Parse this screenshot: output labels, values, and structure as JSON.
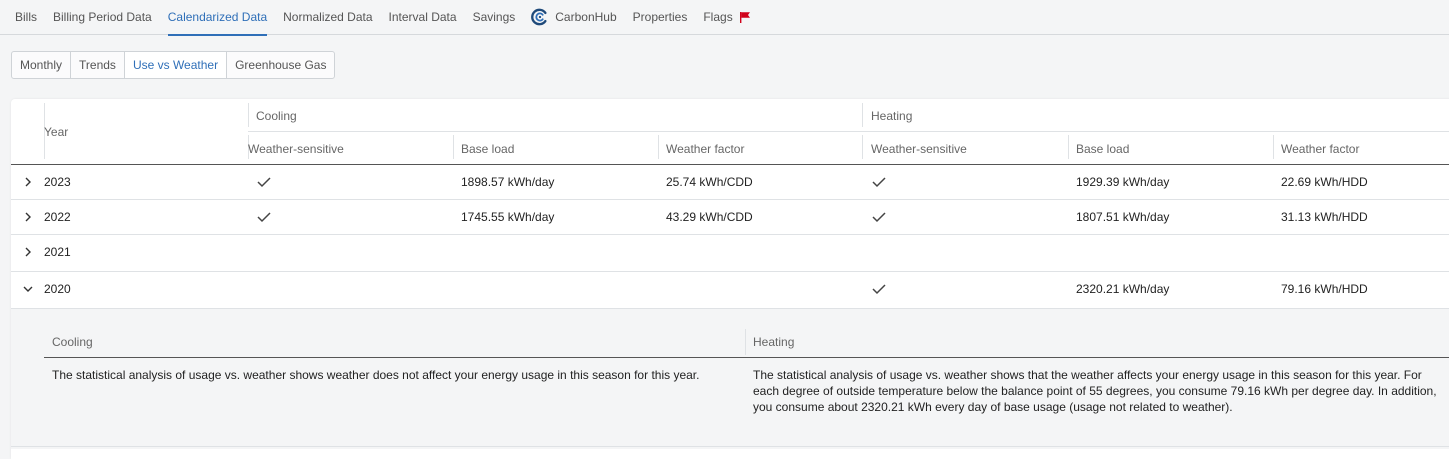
{
  "nav": {
    "tabs": [
      {
        "label": "Bills",
        "active": false
      },
      {
        "label": "Billing Period Data",
        "active": false
      },
      {
        "label": "Calendarized Data",
        "active": true
      },
      {
        "label": "Normalized Data",
        "active": false
      },
      {
        "label": "Interval Data",
        "active": false
      },
      {
        "label": "Savings",
        "active": false
      },
      {
        "label": "CarbonHub",
        "active": false,
        "icon": "carbonhub-logo-icon"
      },
      {
        "label": "Properties",
        "active": false
      },
      {
        "label": "Flags",
        "active": false,
        "icon": "flag-icon"
      }
    ]
  },
  "subtabs": [
    {
      "label": "Monthly",
      "active": false
    },
    {
      "label": "Trends",
      "active": false
    },
    {
      "label": "Use vs Weather",
      "active": true
    },
    {
      "label": "Greenhouse Gas",
      "active": false
    }
  ],
  "table": {
    "year_header": "Year",
    "groups": {
      "cooling": "Cooling",
      "heating": "Heating"
    },
    "columns": {
      "cool_ws": "Weather-sensitive",
      "cool_base": "Base load",
      "cool_wf": "Weather factor",
      "heat_ws": "Weather-sensitive",
      "heat_base": "Base load",
      "heat_wf": "Weather factor"
    },
    "rows": [
      {
        "year": "2023",
        "expanded": false,
        "cool_ws": true,
        "cool_base": "1898.57 kWh/day",
        "cool_wf": "25.74 kWh/CDD",
        "heat_ws": true,
        "heat_base": "1929.39 kWh/day",
        "heat_wf": "22.69 kWh/HDD"
      },
      {
        "year": "2022",
        "expanded": false,
        "cool_ws": true,
        "cool_base": "1745.55 kWh/day",
        "cool_wf": "43.29 kWh/CDD",
        "heat_ws": true,
        "heat_base": "1807.51 kWh/day",
        "heat_wf": "31.13 kWh/HDD"
      },
      {
        "year": "2021",
        "expanded": false,
        "cool_ws": false,
        "cool_base": "",
        "cool_wf": "",
        "heat_ws": false,
        "heat_base": "",
        "heat_wf": ""
      },
      {
        "year": "2020",
        "expanded": true,
        "cool_ws": false,
        "cool_base": "",
        "cool_wf": "",
        "heat_ws": true,
        "heat_base": "2320.21 kWh/day",
        "heat_wf": "79.16 kWh/HDD"
      }
    ]
  },
  "detail": {
    "cooling_header": "Cooling",
    "heating_header": "Heating",
    "cooling_text": "The statistical analysis of usage vs. weather shows weather does not affect your energy usage in this season for this year.",
    "heating_text_line1": "The statistical analysis of usage vs. weather shows that the weather affects your energy usage in this season for this year. For",
    "heating_text_line2": "each degree of outside temperature below the balance point of 55 degrees, you consume 79.16 kWh per degree day. In addition,",
    "heating_text_line3": "you consume about 2320.21 kWh every day of base usage (usage not related to weather)."
  },
  "colors": {
    "accent": "#2f6fb8",
    "flag": "#d0021b",
    "carbonhub": "#1f4a7a"
  }
}
